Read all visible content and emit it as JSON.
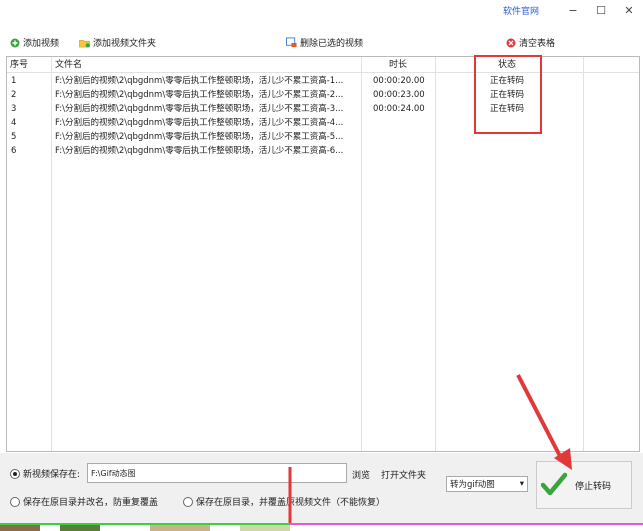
{
  "titlebar": {
    "official_site": "软件官网",
    "minimize": "−",
    "maximize": "☐",
    "close": "✕"
  },
  "toolbar": {
    "add_video": "添加视频",
    "add_folder": "添加视频文件夹",
    "delete_selected": "删除已选的视频",
    "clear_table": "清空表格"
  },
  "table": {
    "headers": {
      "index": "序号",
      "filename": "文件名",
      "duration": "时长",
      "status": "状态"
    },
    "rows": [
      {
        "index": "1",
        "filename": "F:\\分割后的视频\\2\\qbgdnm\\零零后执工作整顿职场，活儿少不累工资高-1...",
        "duration": "00:00:20.00",
        "status": "正在转码"
      },
      {
        "index": "2",
        "filename": "F:\\分割后的视频\\2\\qbgdnm\\零零后执工作整顿职场，活儿少不累工资高-2...",
        "duration": "00:00:23.00",
        "status": "正在转码"
      },
      {
        "index": "3",
        "filename": "F:\\分割后的视频\\2\\qbgdnm\\零零后执工作整顿职场，活儿少不累工资高-3...",
        "duration": "00:00:24.00",
        "status": "正在转码"
      },
      {
        "index": "4",
        "filename": "F:\\分割后的视频\\2\\qbgdnm\\零零后执工作整顿职场，活儿少不累工资高-4...",
        "duration": "",
        "status": ""
      },
      {
        "index": "5",
        "filename": "F:\\分割后的视频\\2\\qbgdnm\\零零后执工作整顿职场，活儿少不累工资高-5...",
        "duration": "",
        "status": ""
      },
      {
        "index": "6",
        "filename": "F:\\分割后的视频\\2\\qbgdnm\\零零后执工作整顿职场，活儿少不累工资高-6...",
        "duration": "",
        "status": ""
      }
    ]
  },
  "output": {
    "save_new_label": "新视频保存在:",
    "save_path": "F:\\Gif动态图",
    "browse": "浏览",
    "open_folder": "打开文件夹",
    "save_original_rename": "保存在原目录并改名，防重复覆盖",
    "save_original_overwrite": "保存在原目录，并覆盖原视频文件（不能恢复）"
  },
  "convert": {
    "format_selected": "转为gif动图",
    "stop_label": "停止转码"
  },
  "colors": {
    "accent_red": "#e1383a",
    "link_blue": "#2a5bd7",
    "check_green": "#3aa53a"
  }
}
